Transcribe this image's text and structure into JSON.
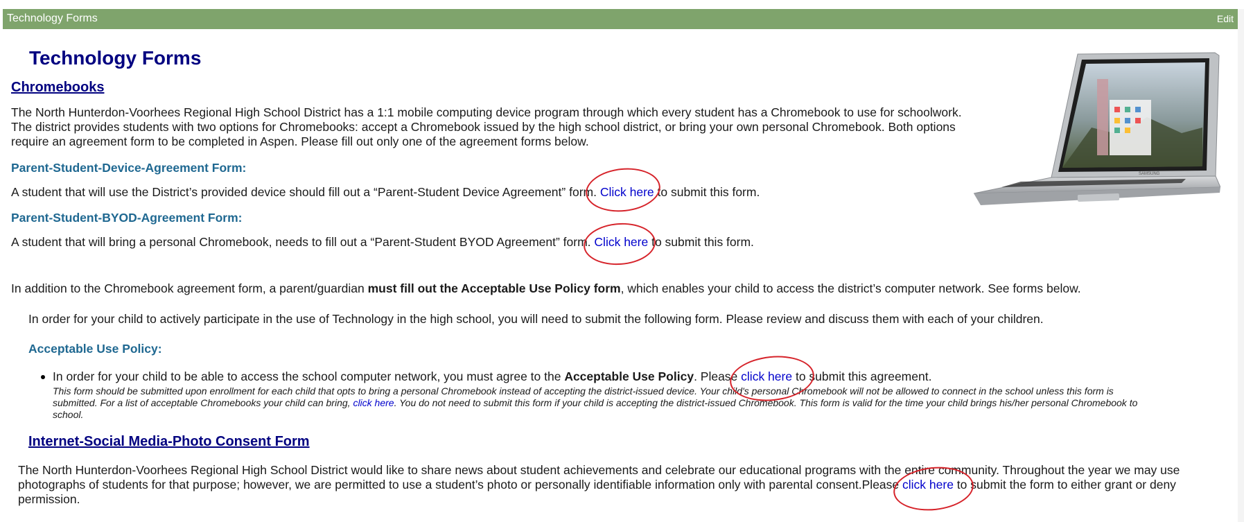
{
  "header": {
    "title": "Technology Forms",
    "edit_label": "Edit"
  },
  "page_title": "Technology Forms",
  "chromebooks": {
    "title": "Chromebooks",
    "intro_lines": [
      "The North Hunterdon-Voorhees Regional High School District has a 1:1 mobile computing device program through which every student has a Chromebook to use for schoolwork.",
      "The district provides students with two options for Chromebooks:  accept a Chromebook issued by the high school district, or bring your own personal Chromebook.  Both options",
      "require an agreement form to be completed in Aspen. Please fill out only one of the agreement forms below."
    ],
    "device_form": {
      "heading": "Parent-Student-Device-Agreement Form:",
      "text_before": "A student that will use the District’s provided device should fill out a “Parent-Student Device Agreement” form. ",
      "link": "Click here",
      "text_after": " to submit this form."
    },
    "byod_form": {
      "heading": "Parent-Student-BYOD-Agreement Form:",
      "text_before": "A student that will bring a personal Chromebook, needs to fill out a “Parent-Student BYOD Agreement” form. ",
      "link": "Click here",
      "text_after": " to submit this form."
    }
  },
  "aup_intro": {
    "before": "In addition to the Chromebook agreement form, a parent/guardian ",
    "bold": "must fill out the Acceptable Use Policy form",
    "after": ", which enables your child to access the district’s computer network.  See forms below."
  },
  "participate_text": "In order for your child to actively participate in the use of Technology in the high school, you will need to submit the following form.  Please review and discuss them with each of your children.",
  "aup": {
    "heading": "Acceptable Use Policy:",
    "bullet_before": "In order for your child to be able to access the school computer network, you must agree to the ",
    "bullet_bold": "Acceptable Use Policy",
    "bullet_mid": ". Please ",
    "bullet_link": "click here",
    "bullet_after": " to submit this agreement.",
    "note_line1": "This form should be submitted upon enrollment for each child that opts to bring a personal Chromebook instead of accepting the district-issued device. Your child's personal Chromebook will not be allowed to connect in the school unless this form is",
    "note_line2_before": "submitted. For a list of acceptable Chromebooks your child can bring, ",
    "note_link": "click here",
    "note_line2_after": ". You do not need to submit this form if your child is accepting the district-issued Chromebook. This form is valid for the time your child brings his/her personal Chromebook to",
    "note_line3": "school."
  },
  "consent": {
    "title": "Internet-Social Media-Photo Consent Form",
    "line1": "The North Hunterdon-Voorhees Regional High School District would like to share news about student achievements and celebrate our educational programs with the entire community.  Throughout the year we may use",
    "line2_before": "photographs of students for that purpose; however, we are permitted to use a student’s photo or personally identifiable information only with parental consent.Please ",
    "link": "click here",
    "line2_after": " to submit the form to either grant or deny",
    "line3": "permission."
  },
  "image": {
    "brand": "SAMSUNG"
  },
  "colors": {
    "header_bar": "#7fa46c",
    "heading": "#000080",
    "subheading": "#1f6891",
    "link": "#0000cc",
    "annotation": "#d6232a"
  }
}
